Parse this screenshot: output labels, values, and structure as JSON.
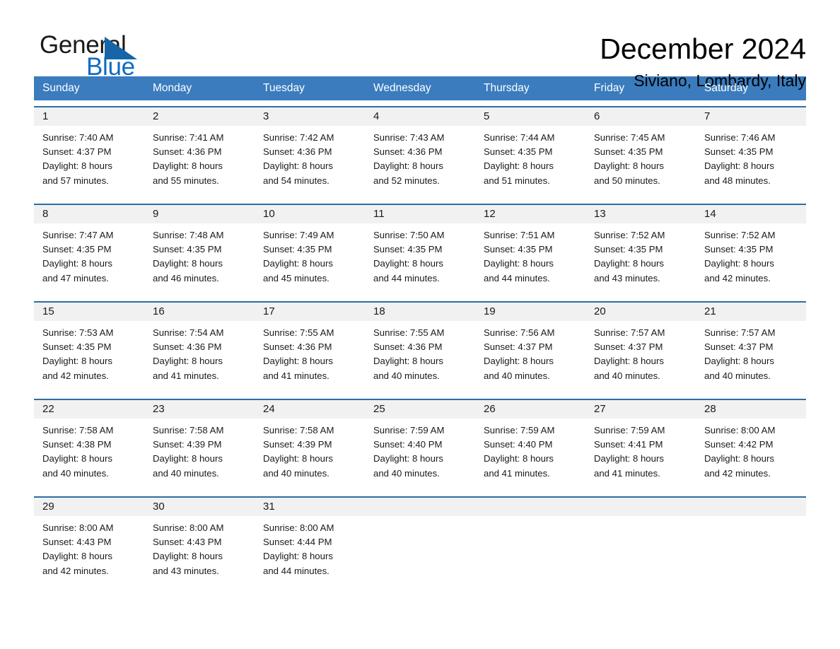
{
  "brand": {
    "name_part1": "General",
    "name_part2": "Blue",
    "logo_icon": "triangle-icon",
    "accent_color": "#1565a8",
    "blue_text_color": "#0f6cc0"
  },
  "header": {
    "title": "December 2024",
    "subtitle": "Siviano, Lombardy, Italy"
  },
  "theme": {
    "header_row_color": "#3a7cbe",
    "week_divider_color": "#2e6da4",
    "daynum_band_color": "#f1f1f1"
  },
  "weekdays": [
    "Sunday",
    "Monday",
    "Tuesday",
    "Wednesday",
    "Thursday",
    "Friday",
    "Saturday"
  ],
  "weeks": [
    {
      "days": [
        {
          "num": "1",
          "sunrise": "Sunrise: 7:40 AM",
          "sunset": "Sunset: 4:37 PM",
          "daylight_line1": "Daylight: 8 hours",
          "daylight_line2": "and 57 minutes."
        },
        {
          "num": "2",
          "sunrise": "Sunrise: 7:41 AM",
          "sunset": "Sunset: 4:36 PM",
          "daylight_line1": "Daylight: 8 hours",
          "daylight_line2": "and 55 minutes."
        },
        {
          "num": "3",
          "sunrise": "Sunrise: 7:42 AM",
          "sunset": "Sunset: 4:36 PM",
          "daylight_line1": "Daylight: 8 hours",
          "daylight_line2": "and 54 minutes."
        },
        {
          "num": "4",
          "sunrise": "Sunrise: 7:43 AM",
          "sunset": "Sunset: 4:36 PM",
          "daylight_line1": "Daylight: 8 hours",
          "daylight_line2": "and 52 minutes."
        },
        {
          "num": "5",
          "sunrise": "Sunrise: 7:44 AM",
          "sunset": "Sunset: 4:35 PM",
          "daylight_line1": "Daylight: 8 hours",
          "daylight_line2": "and 51 minutes."
        },
        {
          "num": "6",
          "sunrise": "Sunrise: 7:45 AM",
          "sunset": "Sunset: 4:35 PM",
          "daylight_line1": "Daylight: 8 hours",
          "daylight_line2": "and 50 minutes."
        },
        {
          "num": "7",
          "sunrise": "Sunrise: 7:46 AM",
          "sunset": "Sunset: 4:35 PM",
          "daylight_line1": "Daylight: 8 hours",
          "daylight_line2": "and 48 minutes."
        }
      ]
    },
    {
      "days": [
        {
          "num": "8",
          "sunrise": "Sunrise: 7:47 AM",
          "sunset": "Sunset: 4:35 PM",
          "daylight_line1": "Daylight: 8 hours",
          "daylight_line2": "and 47 minutes."
        },
        {
          "num": "9",
          "sunrise": "Sunrise: 7:48 AM",
          "sunset": "Sunset: 4:35 PM",
          "daylight_line1": "Daylight: 8 hours",
          "daylight_line2": "and 46 minutes."
        },
        {
          "num": "10",
          "sunrise": "Sunrise: 7:49 AM",
          "sunset": "Sunset: 4:35 PM",
          "daylight_line1": "Daylight: 8 hours",
          "daylight_line2": "and 45 minutes."
        },
        {
          "num": "11",
          "sunrise": "Sunrise: 7:50 AM",
          "sunset": "Sunset: 4:35 PM",
          "daylight_line1": "Daylight: 8 hours",
          "daylight_line2": "and 44 minutes."
        },
        {
          "num": "12",
          "sunrise": "Sunrise: 7:51 AM",
          "sunset": "Sunset: 4:35 PM",
          "daylight_line1": "Daylight: 8 hours",
          "daylight_line2": "and 44 minutes."
        },
        {
          "num": "13",
          "sunrise": "Sunrise: 7:52 AM",
          "sunset": "Sunset: 4:35 PM",
          "daylight_line1": "Daylight: 8 hours",
          "daylight_line2": "and 43 minutes."
        },
        {
          "num": "14",
          "sunrise": "Sunrise: 7:52 AM",
          "sunset": "Sunset: 4:35 PM",
          "daylight_line1": "Daylight: 8 hours",
          "daylight_line2": "and 42 minutes."
        }
      ]
    },
    {
      "days": [
        {
          "num": "15",
          "sunrise": "Sunrise: 7:53 AM",
          "sunset": "Sunset: 4:35 PM",
          "daylight_line1": "Daylight: 8 hours",
          "daylight_line2": "and 42 minutes."
        },
        {
          "num": "16",
          "sunrise": "Sunrise: 7:54 AM",
          "sunset": "Sunset: 4:36 PM",
          "daylight_line1": "Daylight: 8 hours",
          "daylight_line2": "and 41 minutes."
        },
        {
          "num": "17",
          "sunrise": "Sunrise: 7:55 AM",
          "sunset": "Sunset: 4:36 PM",
          "daylight_line1": "Daylight: 8 hours",
          "daylight_line2": "and 41 minutes."
        },
        {
          "num": "18",
          "sunrise": "Sunrise: 7:55 AM",
          "sunset": "Sunset: 4:36 PM",
          "daylight_line1": "Daylight: 8 hours",
          "daylight_line2": "and 40 minutes."
        },
        {
          "num": "19",
          "sunrise": "Sunrise: 7:56 AM",
          "sunset": "Sunset: 4:37 PM",
          "daylight_line1": "Daylight: 8 hours",
          "daylight_line2": "and 40 minutes."
        },
        {
          "num": "20",
          "sunrise": "Sunrise: 7:57 AM",
          "sunset": "Sunset: 4:37 PM",
          "daylight_line1": "Daylight: 8 hours",
          "daylight_line2": "and 40 minutes."
        },
        {
          "num": "21",
          "sunrise": "Sunrise: 7:57 AM",
          "sunset": "Sunset: 4:37 PM",
          "daylight_line1": "Daylight: 8 hours",
          "daylight_line2": "and 40 minutes."
        }
      ]
    },
    {
      "days": [
        {
          "num": "22",
          "sunrise": "Sunrise: 7:58 AM",
          "sunset": "Sunset: 4:38 PM",
          "daylight_line1": "Daylight: 8 hours",
          "daylight_line2": "and 40 minutes."
        },
        {
          "num": "23",
          "sunrise": "Sunrise: 7:58 AM",
          "sunset": "Sunset: 4:39 PM",
          "daylight_line1": "Daylight: 8 hours",
          "daylight_line2": "and 40 minutes."
        },
        {
          "num": "24",
          "sunrise": "Sunrise: 7:58 AM",
          "sunset": "Sunset: 4:39 PM",
          "daylight_line1": "Daylight: 8 hours",
          "daylight_line2": "and 40 minutes."
        },
        {
          "num": "25",
          "sunrise": "Sunrise: 7:59 AM",
          "sunset": "Sunset: 4:40 PM",
          "daylight_line1": "Daylight: 8 hours",
          "daylight_line2": "and 40 minutes."
        },
        {
          "num": "26",
          "sunrise": "Sunrise: 7:59 AM",
          "sunset": "Sunset: 4:40 PM",
          "daylight_line1": "Daylight: 8 hours",
          "daylight_line2": "and 41 minutes."
        },
        {
          "num": "27",
          "sunrise": "Sunrise: 7:59 AM",
          "sunset": "Sunset: 4:41 PM",
          "daylight_line1": "Daylight: 8 hours",
          "daylight_line2": "and 41 minutes."
        },
        {
          "num": "28",
          "sunrise": "Sunrise: 8:00 AM",
          "sunset": "Sunset: 4:42 PM",
          "daylight_line1": "Daylight: 8 hours",
          "daylight_line2": "and 42 minutes."
        }
      ]
    },
    {
      "days": [
        {
          "num": "29",
          "sunrise": "Sunrise: 8:00 AM",
          "sunset": "Sunset: 4:43 PM",
          "daylight_line1": "Daylight: 8 hours",
          "daylight_line2": "and 42 minutes."
        },
        {
          "num": "30",
          "sunrise": "Sunrise: 8:00 AM",
          "sunset": "Sunset: 4:43 PM",
          "daylight_line1": "Daylight: 8 hours",
          "daylight_line2": "and 43 minutes."
        },
        {
          "num": "31",
          "sunrise": "Sunrise: 8:00 AM",
          "sunset": "Sunset: 4:44 PM",
          "daylight_line1": "Daylight: 8 hours",
          "daylight_line2": "and 44 minutes."
        },
        {
          "num": "",
          "sunrise": "",
          "sunset": "",
          "daylight_line1": "",
          "daylight_line2": ""
        },
        {
          "num": "",
          "sunrise": "",
          "sunset": "",
          "daylight_line1": "",
          "daylight_line2": ""
        },
        {
          "num": "",
          "sunrise": "",
          "sunset": "",
          "daylight_line1": "",
          "daylight_line2": ""
        },
        {
          "num": "",
          "sunrise": "",
          "sunset": "",
          "daylight_line1": "",
          "daylight_line2": ""
        }
      ]
    }
  ]
}
